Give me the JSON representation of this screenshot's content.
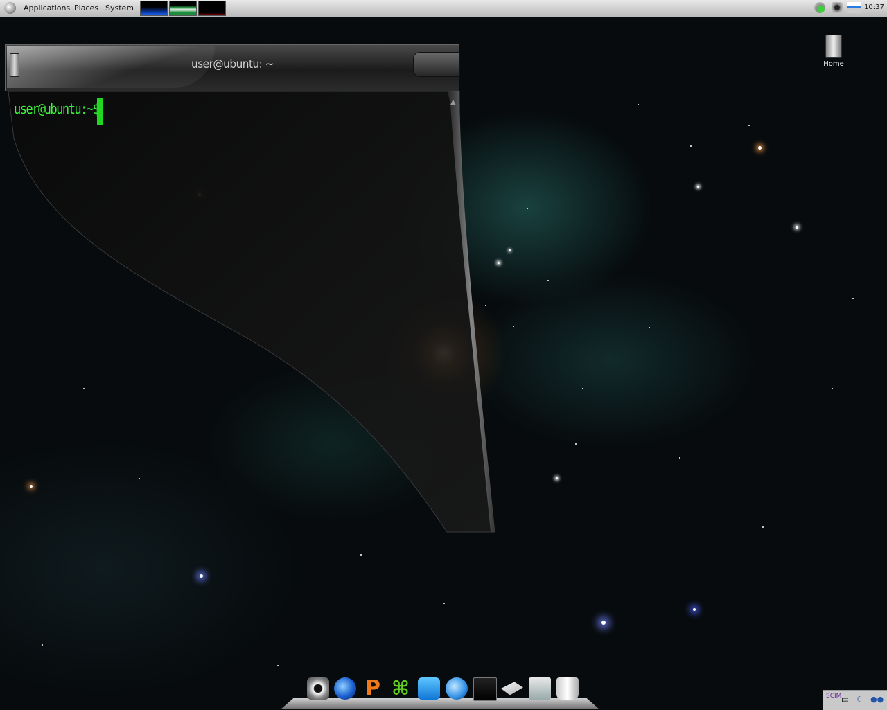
{
  "top_panel": {
    "menus": [
      "Applications",
      "Places",
      "System"
    ],
    "clock": "10:37",
    "applets": [
      "cpu-monitor-applet",
      "memory-monitor-applet",
      "network-monitor-applet"
    ],
    "tray_icons": [
      "notification-icon",
      "camera-icon",
      "network-icon"
    ]
  },
  "desktop": {
    "icons": [
      {
        "label": "Home",
        "icon": "home-icon"
      }
    ]
  },
  "terminal": {
    "title": "user@ubuntu: ~",
    "prompt": "user@ubuntu:~$",
    "text_color": "#3cf03c"
  },
  "dock": {
    "icons": [
      "camera-icon",
      "browser-icon",
      "pidgin-icon",
      "xchat-icon",
      "writer-icon",
      "video-chat-icon",
      "terminal-icon",
      "mail-icon",
      "settings-icon",
      "trash-icon"
    ]
  },
  "bottom_right": {
    "input_method": "SCIM",
    "ime_label": "中"
  },
  "colors": {
    "panel": "#c8c8c8",
    "terminal_bg": "#101010",
    "prompt_green": "#3cf03c"
  }
}
